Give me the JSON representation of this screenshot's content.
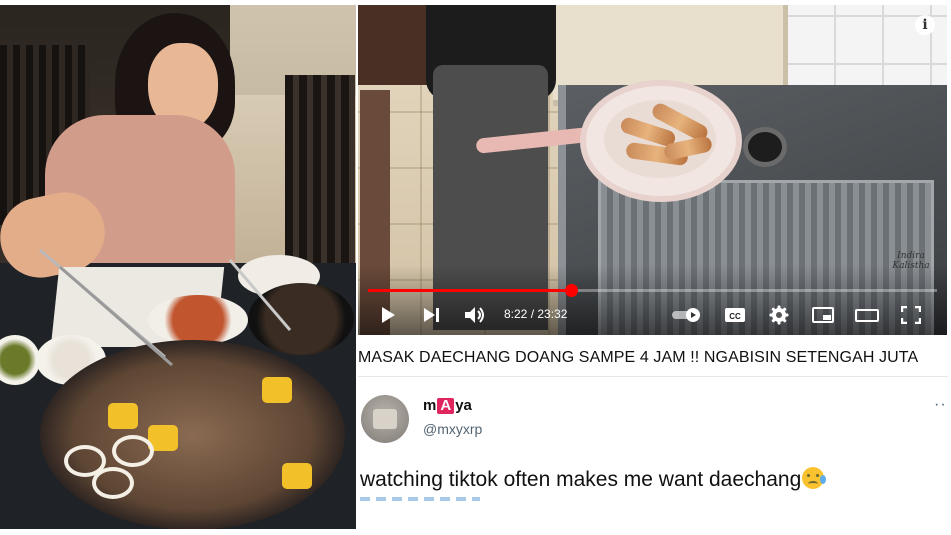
{
  "video": {
    "current_time": "8:22",
    "duration": "23:32",
    "time_display": "8:22 / 23:32",
    "progress_fraction": 0.356,
    "watermark": "Indira Kalistha",
    "info_label": "i",
    "cc_label": "CC",
    "icons": [
      "play-icon",
      "next-icon",
      "volume-icon",
      "autoplay-toggle-icon",
      "captions-icon",
      "settings-gear-icon",
      "miniplayer-icon",
      "theater-mode-icon",
      "fullscreen-icon"
    ]
  },
  "video_title": "MASAK DAECHANG DOANG SAMPE 4 JAM !! NGABISIN SETENGAH JUTA",
  "tweet": {
    "display_name": "mAya",
    "handle": "@mxyxrp",
    "text": "watching tiktok often makes me want daechang",
    "emoji": "crying-face",
    "more_label": "··"
  },
  "colors": {
    "progress_red": "#ff0000",
    "handle_gray": "#536471",
    "name_badge_red": "#e0245e"
  }
}
